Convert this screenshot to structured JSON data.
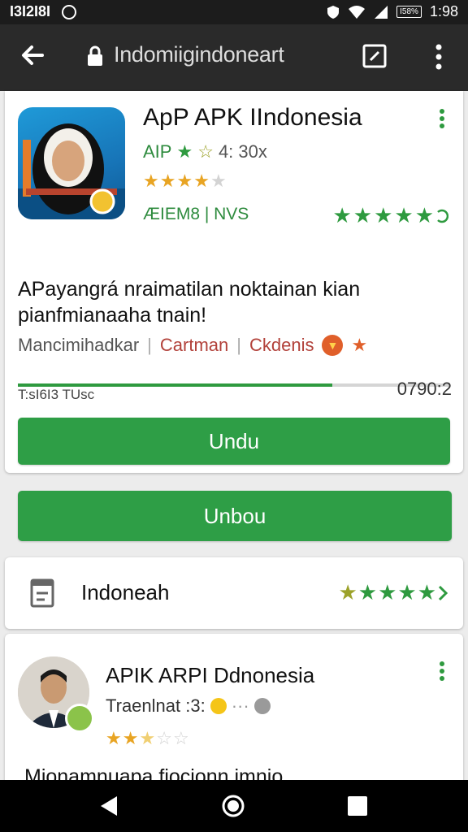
{
  "status_bar": {
    "left_text": "I3I2I8I",
    "battery_text": "I58%",
    "time": "1:98"
  },
  "browser": {
    "url": "Indomiigindoneart"
  },
  "app_card": {
    "title": "ApP APK IIndonesia",
    "subtitle_prefix": "AIP",
    "subtitle_rating": "4: 30x",
    "rating": 4,
    "meta": "ÆIEM8  |  NVS",
    "green_stars": 5,
    "description": "APayangrá nraimatilan noktainan kian pianfmianaaha tnain!",
    "tags": {
      "tag1": "Mancimihadkar",
      "tag2": "Cartman",
      "tag3": "Ckdenis"
    },
    "progress": {
      "fraction": 0.73,
      "left_label": "T:sI6I3 TUsc",
      "right_label": "0790:2"
    },
    "primary_button": "Undu"
  },
  "secondary_button": "Unbou",
  "review_card": {
    "label": "Indoneah",
    "stars": 5
  },
  "second_app": {
    "title": "APIK ARPI Ddnonesia",
    "subtitle": "Traenlnat :3:",
    "rating": 2.5,
    "description": "Mionamnuapa fiocionn imnio"
  },
  "colors": {
    "accent": "#2e9e46",
    "star_gold": "#e8a423",
    "star_green": "#2e9a3f",
    "toolbar": "#2a2a2a"
  }
}
